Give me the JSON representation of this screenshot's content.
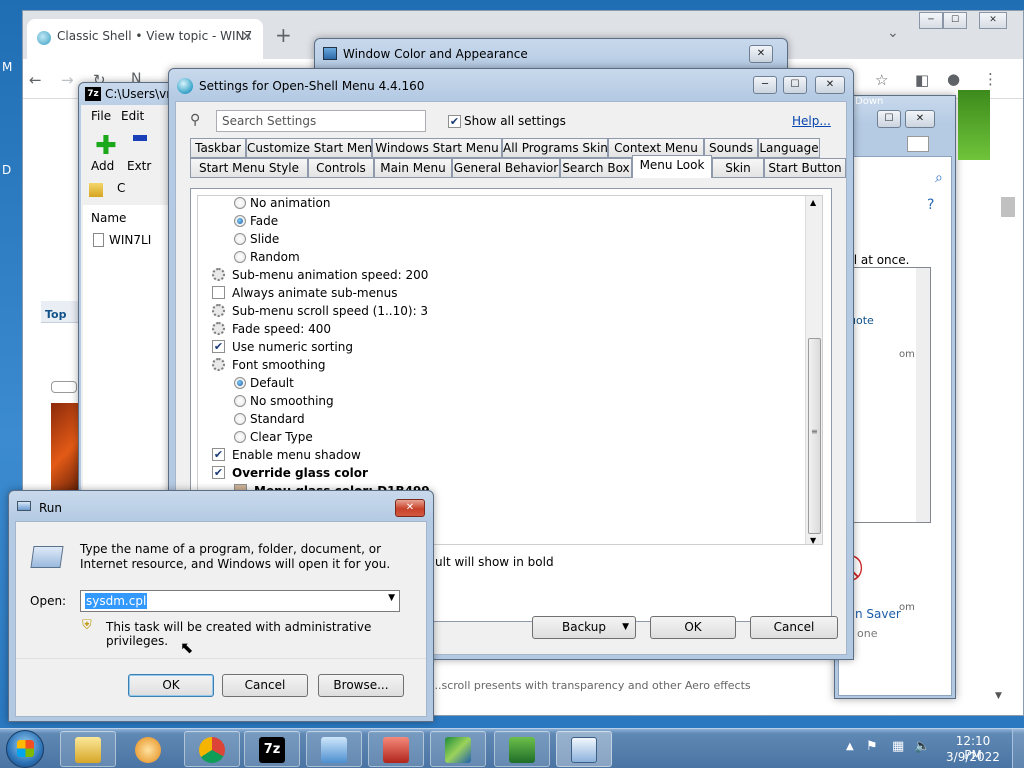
{
  "desktop": {
    "left_labels": [
      "M",
      "D"
    ]
  },
  "chrome": {
    "tab_title": "Classic Shell • View topic - WIN7",
    "address_text": "N",
    "bottom_text": "...scroll presents with transparency and other Aero effects",
    "side_labels": {
      "top": "Top",
      "quote": "uote",
      "all_at_once": "all at once.",
      "om1": "om",
      "om2": "om",
      "screen_saver": "n Saver",
      "one": "one",
      "down": "Down"
    }
  },
  "wca": {
    "title": "Window Color and Appearance"
  },
  "zip": {
    "title": "C:\\Users\\vm",
    "menu": [
      "File",
      "Edit"
    ],
    "toolbar": [
      "Add",
      "Extr"
    ],
    "path_fragment": "C",
    "col_name": "Name",
    "file": "WIN7LI"
  },
  "settings": {
    "title": "Settings for Open-Shell Menu 4.4.160",
    "search_placeholder": "Search Settings",
    "show_all": "Show all settings",
    "help": "Help...",
    "tabs_row1": [
      "Taskbar",
      "Customize Start Menu",
      "Windows Start Menu",
      "All Programs Skin",
      "Context Menu",
      "Sounds",
      "Language"
    ],
    "tabs_row2": [
      "Start Menu Style",
      "Controls",
      "Main Menu",
      "General Behavior",
      "Search Box",
      "Menu Look",
      "Skin",
      "Start Button"
    ],
    "active_tab": "Menu Look",
    "items": [
      {
        "kind": "radio",
        "indent": 1,
        "checked": false,
        "label": "No animation"
      },
      {
        "kind": "radio",
        "indent": 1,
        "checked": true,
        "label": "Fade"
      },
      {
        "kind": "radio",
        "indent": 1,
        "checked": false,
        "label": "Slide"
      },
      {
        "kind": "radio",
        "indent": 1,
        "checked": false,
        "label": "Random"
      },
      {
        "kind": "gear",
        "indent": 0,
        "checked": false,
        "label": "Sub-menu animation speed: 200"
      },
      {
        "kind": "check",
        "indent": 0,
        "checked": false,
        "label": "Always animate sub-menus"
      },
      {
        "kind": "gear",
        "indent": 0,
        "checked": false,
        "label": "Sub-menu scroll speed (1..10): 3"
      },
      {
        "kind": "gear",
        "indent": 0,
        "checked": false,
        "label": "Fade speed: 400"
      },
      {
        "kind": "check",
        "indent": 0,
        "checked": true,
        "label": "Use numeric sorting"
      },
      {
        "kind": "gear",
        "indent": 0,
        "checked": false,
        "label": "Font smoothing"
      },
      {
        "kind": "radio",
        "indent": 1,
        "checked": true,
        "label": "Default"
      },
      {
        "kind": "radio",
        "indent": 1,
        "checked": false,
        "label": "No smoothing"
      },
      {
        "kind": "radio",
        "indent": 1,
        "checked": false,
        "label": "Standard"
      },
      {
        "kind": "radio",
        "indent": 1,
        "checked": false,
        "label": "Clear Type"
      },
      {
        "kind": "check",
        "indent": 0,
        "checked": true,
        "label": "Enable menu shadow"
      },
      {
        "kind": "check",
        "indent": 0,
        "checked": true,
        "label": "Override glass color",
        "bold": true
      },
      {
        "kind": "color",
        "indent": 1,
        "checked": false,
        "label": "Menu glass color: D1B499",
        "bold": true
      }
    ],
    "bold_note": "ult will show in bold",
    "backup": "Backup",
    "ok": "OK",
    "cancel": "Cancel"
  },
  "run": {
    "title": "Run",
    "description": "Type the name of a program, folder, document, or Internet resource, and Windows will open it for you.",
    "open_label": "Open:",
    "open_value": "sysdm.cpl",
    "admin_note": "This task will be created with administrative privileges.",
    "ok": "OK",
    "cancel": "Cancel",
    "browse": "Browse..."
  },
  "taskbar": {
    "apps": [
      "file-explorer",
      "media-player",
      "chrome",
      "7-zip",
      "control-panel",
      "toolbox",
      "display-settings",
      "network-settings",
      "run-dialog"
    ],
    "time": "12:10 PM",
    "date": "3/9/2022"
  }
}
